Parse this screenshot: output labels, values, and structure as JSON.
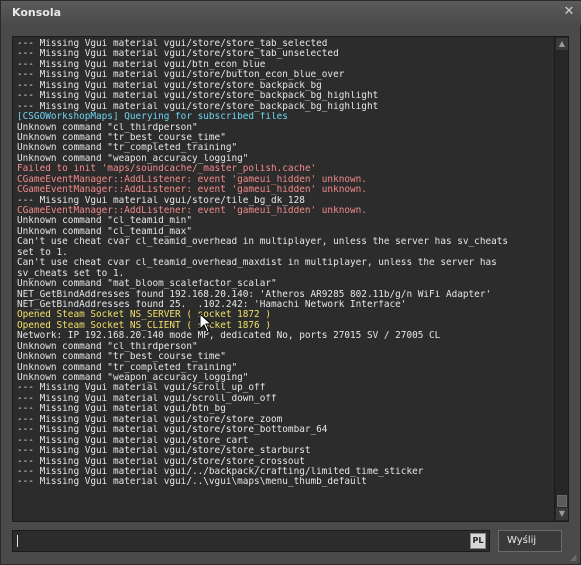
{
  "window": {
    "title": "Konsola"
  },
  "close_icon": "close-icon",
  "console": {
    "lines": [
      {
        "text": "--- Missing Vgui material vgui/store/store_tab_selected",
        "color": "white"
      },
      {
        "text": "--- Missing Vgui material vgui/store/store_tab_unselected",
        "color": "white"
      },
      {
        "text": "--- Missing Vgui material vgui/btn_econ_blue",
        "color": "white"
      },
      {
        "text": "--- Missing Vgui material vgui/store/button_econ_blue_over",
        "color": "white"
      },
      {
        "text": "--- Missing Vgui material vgui/store/store_backpack_bg",
        "color": "white"
      },
      {
        "text": "--- Missing Vgui material vgui/store/store_backpack_bg_highlight",
        "color": "white"
      },
      {
        "text": "--- Missing Vgui material vgui/store/store_backpack_bg_highlight",
        "color": "white"
      },
      {
        "text": "[CSGOWorkshopMaps] Querying for subscribed files",
        "color": "cyan"
      },
      {
        "text": "Unknown command \"cl_thirdperson\"",
        "color": "white"
      },
      {
        "text": "Unknown command \"tr_best_course_time\"",
        "color": "white"
      },
      {
        "text": "Unknown command \"tr_completed_training\"",
        "color": "white"
      },
      {
        "text": "Unknown command \"weapon_accuracy_logging\"",
        "color": "white"
      },
      {
        "text": "Failed to init 'maps/soundcache/_master_polish.cache'",
        "color": "red"
      },
      {
        "text": "CGameEventManager::AddListener: event 'gameui_hidden' unknown.",
        "color": "red"
      },
      {
        "text": "CGameEventManager::AddListener: event 'gameui_hidden' unknown.",
        "color": "red"
      },
      {
        "text": "--- Missing Vgui material vgui/store/tile_bg_dk_128",
        "color": "white"
      },
      {
        "text": "CGameEventManager::AddListener: event 'gameui_hidden' unknown.",
        "color": "red"
      },
      {
        "text": "Unknown command \"cl_teamid_min\"",
        "color": "white"
      },
      {
        "text": "Unknown command \"cl_teamid_max\"",
        "color": "white"
      },
      {
        "text": "Can't use cheat cvar cl_teamid_overhead in multiplayer, unless the server has sv_cheats",
        "color": "white"
      },
      {
        "text": "set to 1.",
        "color": "white"
      },
      {
        "text": "Can't use cheat cvar cl_teamid_overhead_maxdist in multiplayer, unless the server has",
        "color": "white"
      },
      {
        "text": "sv_cheats set to 1.",
        "color": "white"
      },
      {
        "text": "Unknown command \"mat_bloom_scalefactor_scalar\"",
        "color": "white"
      },
      {
        "text": "NET_GetBindAddresses found 192.168.20.140: 'Atheros AR9285 802.11b/g/n WiFi Adapter'",
        "color": "white"
      },
      {
        "text": "NET_GetBindAddresses found 25.  .102.242: 'Hamachi Network Interface'",
        "color": "white"
      },
      {
        "text": "Opened Steam Socket NS_SERVER ( socket 1872 )",
        "color": "yellow"
      },
      {
        "text": "Opened Steam Socket NS_CLIENT ( socket 1876 )",
        "color": "yellow"
      },
      {
        "text": "Network: IP 192.168.20.140 mode MP, dedicated No, ports 27015 SV / 27005 CL",
        "color": "white"
      },
      {
        "text": "Unknown command \"cl_thirdperson\"",
        "color": "white"
      },
      {
        "text": "Unknown command \"tr_best_course_time\"",
        "color": "white"
      },
      {
        "text": "Unknown command \"tr_completed_training\"",
        "color": "white"
      },
      {
        "text": "Unknown command \"weapon_accuracy_logging\"",
        "color": "white"
      },
      {
        "text": "--- Missing Vgui material vgui/scroll_up_off",
        "color": "white"
      },
      {
        "text": "--- Missing Vgui material vgui/scroll_down_off",
        "color": "white"
      },
      {
        "text": "--- Missing Vgui material vgui/btn_bg",
        "color": "white"
      },
      {
        "text": "--- Missing Vgui material vgui/store/store_zoom",
        "color": "white"
      },
      {
        "text": "--- Missing Vgui material vgui/store/store_bottombar_64",
        "color": "white"
      },
      {
        "text": "--- Missing Vgui material vgui/store_cart",
        "color": "white"
      },
      {
        "text": "--- Missing Vgui material vgui/store/store_starburst",
        "color": "white"
      },
      {
        "text": "--- Missing Vgui material vgui/store/store_crossout",
        "color": "white"
      },
      {
        "text": "--- Missing Vgui material vgui/../backpack/crafting/limited_time_sticker",
        "color": "white"
      },
      {
        "text": "--- Missing Vgui material vgui/..\\vgui\\maps\\menu_thumb_default",
        "color": "white"
      }
    ],
    "colors": {
      "white": "#e6e6e6",
      "cyan": "#6ed4f0",
      "red": "#f08a8a",
      "yellow": "#f2e06a"
    }
  },
  "scrollbar": {
    "up_icon": "scroll-up-icon",
    "down_icon": "scroll-down-icon"
  },
  "input": {
    "value": "",
    "language_badge": "PL"
  },
  "submit": {
    "label": "Wyślij"
  }
}
